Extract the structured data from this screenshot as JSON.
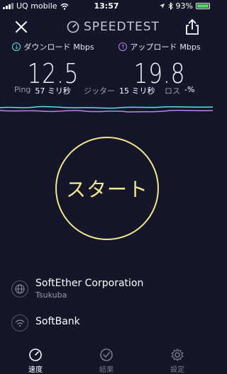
{
  "status_bar": {
    "carrier": "UQ mobile",
    "time": "13:57",
    "battery": "93%"
  },
  "header": {
    "brand": "SPEEDTEST"
  },
  "metrics": {
    "download": {
      "label": "ダウンロード",
      "unit": "Mbps",
      "value": "12.5"
    },
    "upload": {
      "label": "アップロード",
      "unit": "Mbps",
      "value": "19.8"
    }
  },
  "stats": {
    "ping": {
      "label": "Ping",
      "value": "57",
      "unit": "ミリ秒"
    },
    "jitter": {
      "label": "ジッター",
      "value": "15",
      "unit": "ミリ秒"
    },
    "loss": {
      "label": "ロス",
      "value": "-%"
    }
  },
  "start_button": {
    "label": "スタート"
  },
  "server": {
    "name": "SoftEther Corporation",
    "location": "Tsukuba"
  },
  "provider": {
    "name": "SoftBank"
  },
  "nav": {
    "items": [
      {
        "label": "速度"
      },
      {
        "label": "結果"
      },
      {
        "label": "設定"
      }
    ]
  },
  "colors": {
    "background": "#15162a",
    "download_accent": "#5ce1e6",
    "upload_accent": "#b884f0",
    "start_ring": "#f2e98a"
  }
}
